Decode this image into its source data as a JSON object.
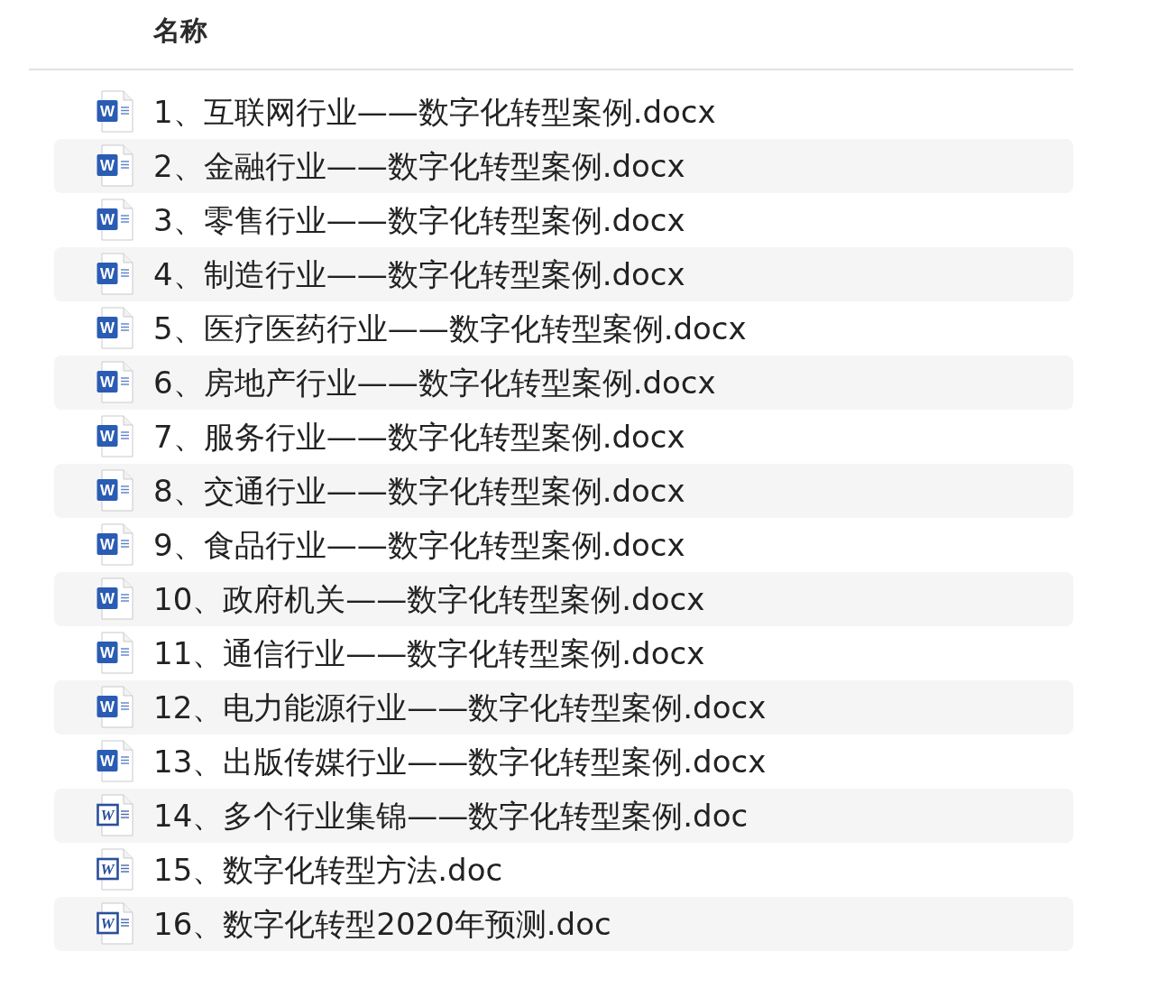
{
  "header": {
    "label": "名称"
  },
  "files": [
    {
      "name": "1、互联网行业——数字化转型案例.docx",
      "kind": "docx",
      "icon_letter": "W",
      "selected": false
    },
    {
      "name": "2、金融行业——数字化转型案例.docx",
      "kind": "docx",
      "icon_letter": "W",
      "selected": false
    },
    {
      "name": "3、零售行业——数字化转型案例.docx",
      "kind": "docx",
      "icon_letter": "W",
      "selected": false
    },
    {
      "name": "4、制造行业——数字化转型案例.docx",
      "kind": "docx",
      "icon_letter": "W",
      "selected": false
    },
    {
      "name": "5、医疗医药行业——数字化转型案例.docx",
      "kind": "docx",
      "icon_letter": "W",
      "selected": false
    },
    {
      "name": "6、房地产行业——数字化转型案例.docx",
      "kind": "docx",
      "icon_letter": "W",
      "selected": false
    },
    {
      "name": "7、服务行业——数字化转型案例.docx",
      "kind": "docx",
      "icon_letter": "W",
      "selected": false
    },
    {
      "name": "8、交通行业——数字化转型案例.docx",
      "kind": "docx",
      "icon_letter": "W",
      "selected": false
    },
    {
      "name": "9、食品行业——数字化转型案例.docx",
      "kind": "docx",
      "icon_letter": "W",
      "selected": false
    },
    {
      "name": "10、政府机关——数字化转型案例.docx",
      "kind": "docx",
      "icon_letter": "W",
      "selected": false
    },
    {
      "name": "11、通信行业——数字化转型案例.docx",
      "kind": "docx",
      "icon_letter": "W",
      "selected": false
    },
    {
      "name": "12、电力能源行业——数字化转型案例.docx",
      "kind": "docx",
      "icon_letter": "W",
      "selected": false
    },
    {
      "name": "13、出版传媒行业——数字化转型案例.docx",
      "kind": "docx",
      "icon_letter": "W",
      "selected": false
    },
    {
      "name": "14、多个行业集锦——数字化转型案例.doc",
      "kind": "doc",
      "icon_letter": "W",
      "selected": false
    },
    {
      "name": "15、数字化转型方法.doc",
      "kind": "doc",
      "icon_letter": "W",
      "selected": false
    },
    {
      "name": "16、数字化转型2020年预测.doc",
      "kind": "doc",
      "icon_letter": "W",
      "selected": false
    }
  ]
}
